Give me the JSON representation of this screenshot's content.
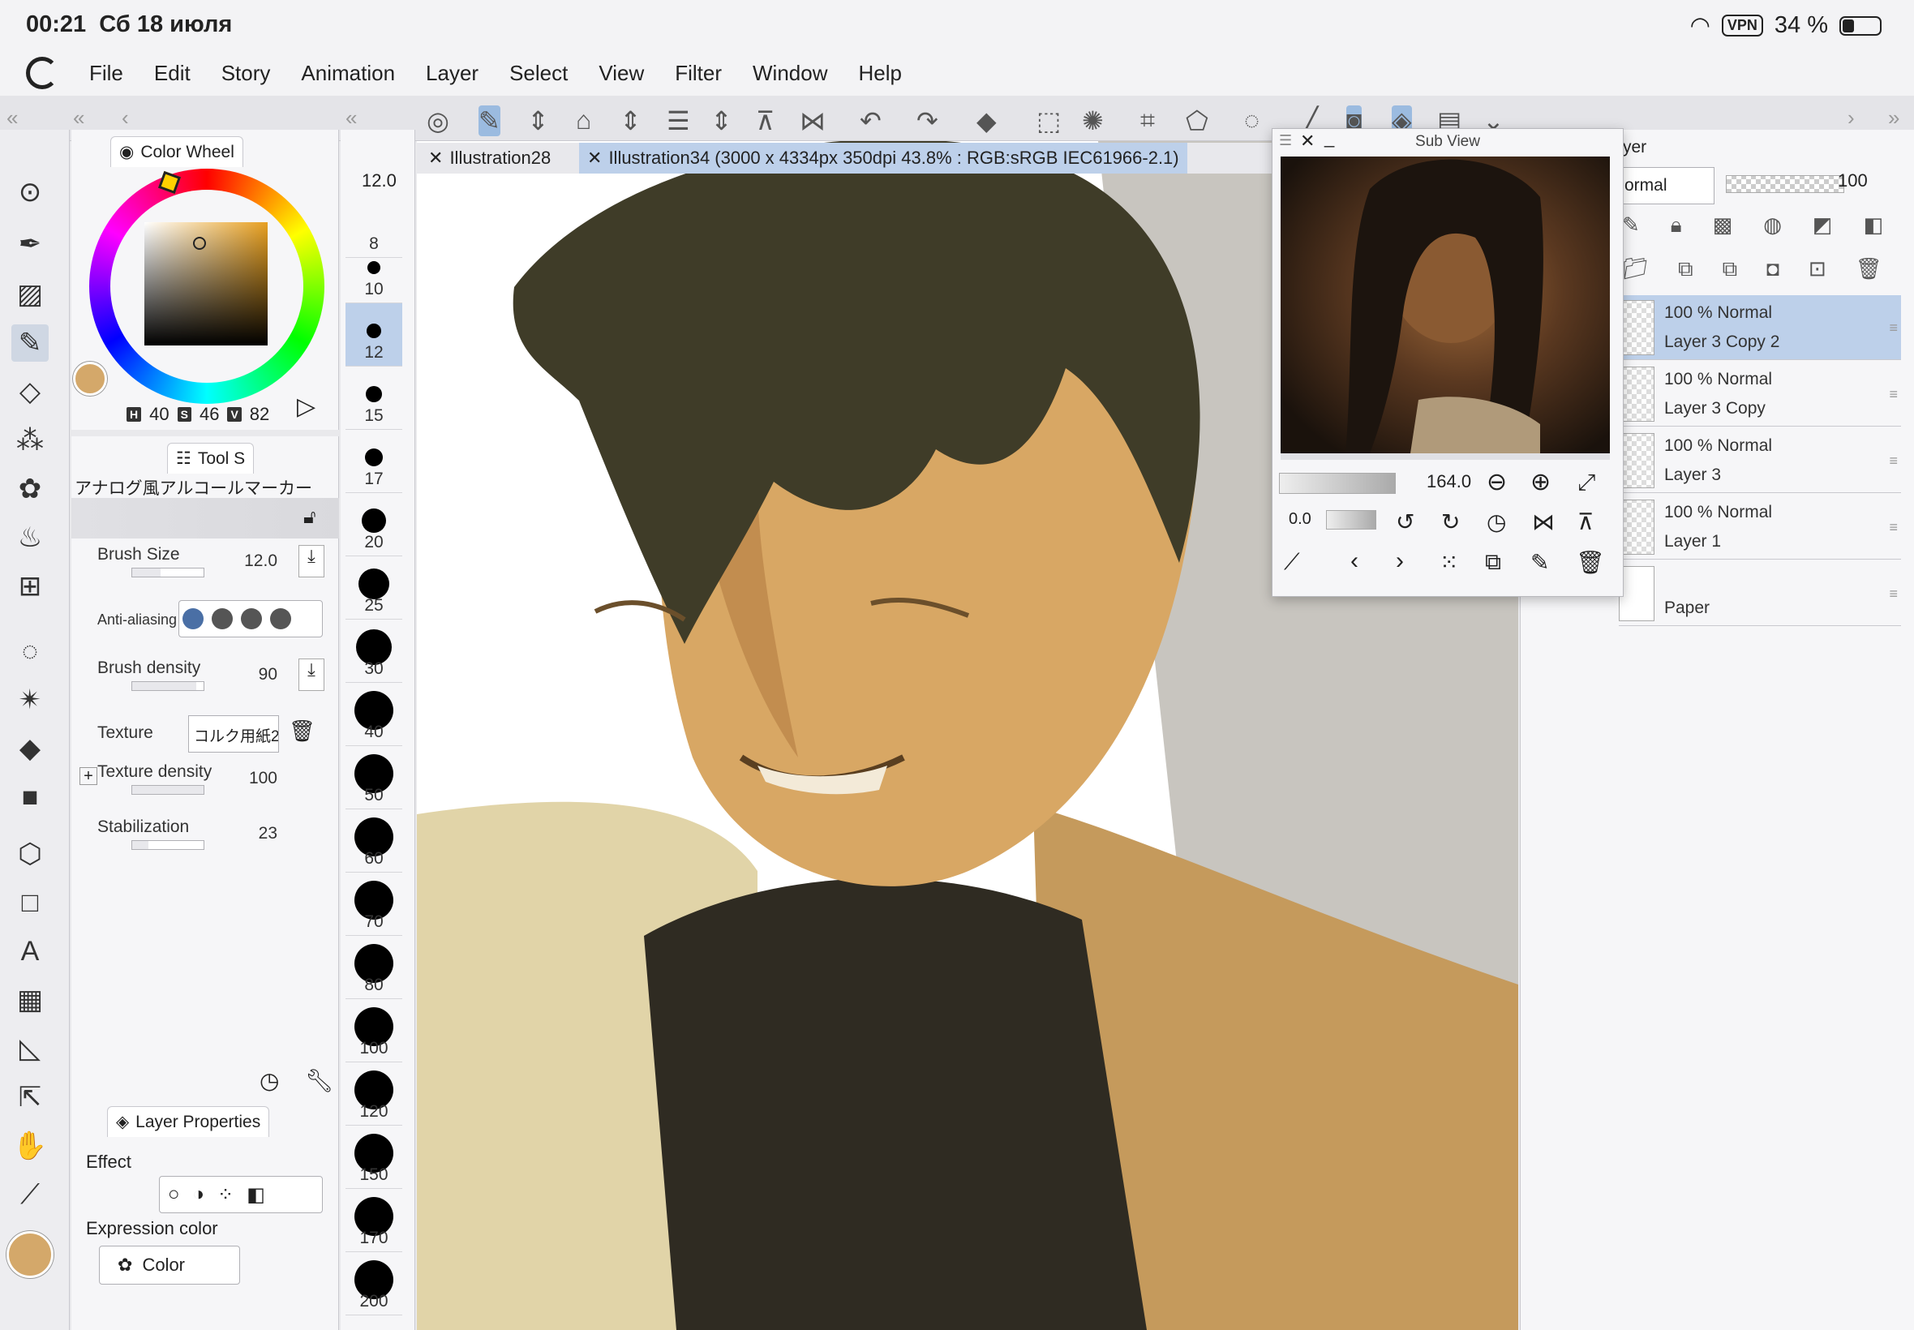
{
  "statusbar": {
    "time": "00:21",
    "date": "Сб 18 июля",
    "vpn": "VPN",
    "battery": "34 %"
  },
  "menu": [
    "File",
    "Edit",
    "Story",
    "Animation",
    "Layer",
    "Select",
    "View",
    "Filter",
    "Window",
    "Help"
  ],
  "color_panel": {
    "tab_label": "Color Wheel",
    "h_key": "H",
    "h": "40",
    "s_key": "S",
    "s": "46",
    "v_key": "V",
    "v": "82",
    "current_color": "#d4a86a"
  },
  "tool_property": {
    "tab_label": "Tool S",
    "brush_name": "アナログ風アルコールマーカー",
    "brush_size_label": "Brush Size",
    "brush_size_value": "12.0",
    "anti_aliasing_label": "Anti-aliasing",
    "brush_density_label": "Brush density",
    "brush_density_value": "90",
    "texture_label": "Texture",
    "texture_value": "コルク用紙2",
    "texture_density_label": "Texture density",
    "texture_density_value": "100",
    "stabilization_label": "Stabilization",
    "stabilization_value": "23"
  },
  "layer_properties": {
    "tab_label": "Layer Properties",
    "effect_label": "Effect",
    "expression_label": "Expression color",
    "expression_value": "Color"
  },
  "brush_sizes": {
    "current": "12.0",
    "items": [
      "8",
      "10",
      "12",
      "15",
      "17",
      "20",
      "25",
      "30",
      "40",
      "50",
      "60",
      "70",
      "80",
      "100",
      "120",
      "150",
      "170",
      "200"
    ]
  },
  "documents": {
    "tab1": "Illustration28",
    "tab2": "Illustration34 (3000 x 4334px 350dpi 43.8% : RGB:sRGB IEC61966-2.1)"
  },
  "subview": {
    "title": "Sub View",
    "zoom": "164.0",
    "rotation": "0.0"
  },
  "layers": {
    "tab_label": "yer",
    "blend_mode": "ormal",
    "opacity": "100",
    "items": [
      {
        "mode": "100 %  Normal",
        "name": "Layer 3 Copy 2"
      },
      {
        "mode": "100 %  Normal",
        "name": "Layer 3 Copy"
      },
      {
        "mode": "100 %  Normal",
        "name": "Layer 3"
      },
      {
        "mode": "100 %  Normal",
        "name": "Layer 1"
      },
      {
        "mode": "",
        "name": "Paper"
      }
    ]
  },
  "colors": {
    "accent": "#bdd0ea",
    "skin": "#d4a86a",
    "hair": "#3d3b28"
  }
}
